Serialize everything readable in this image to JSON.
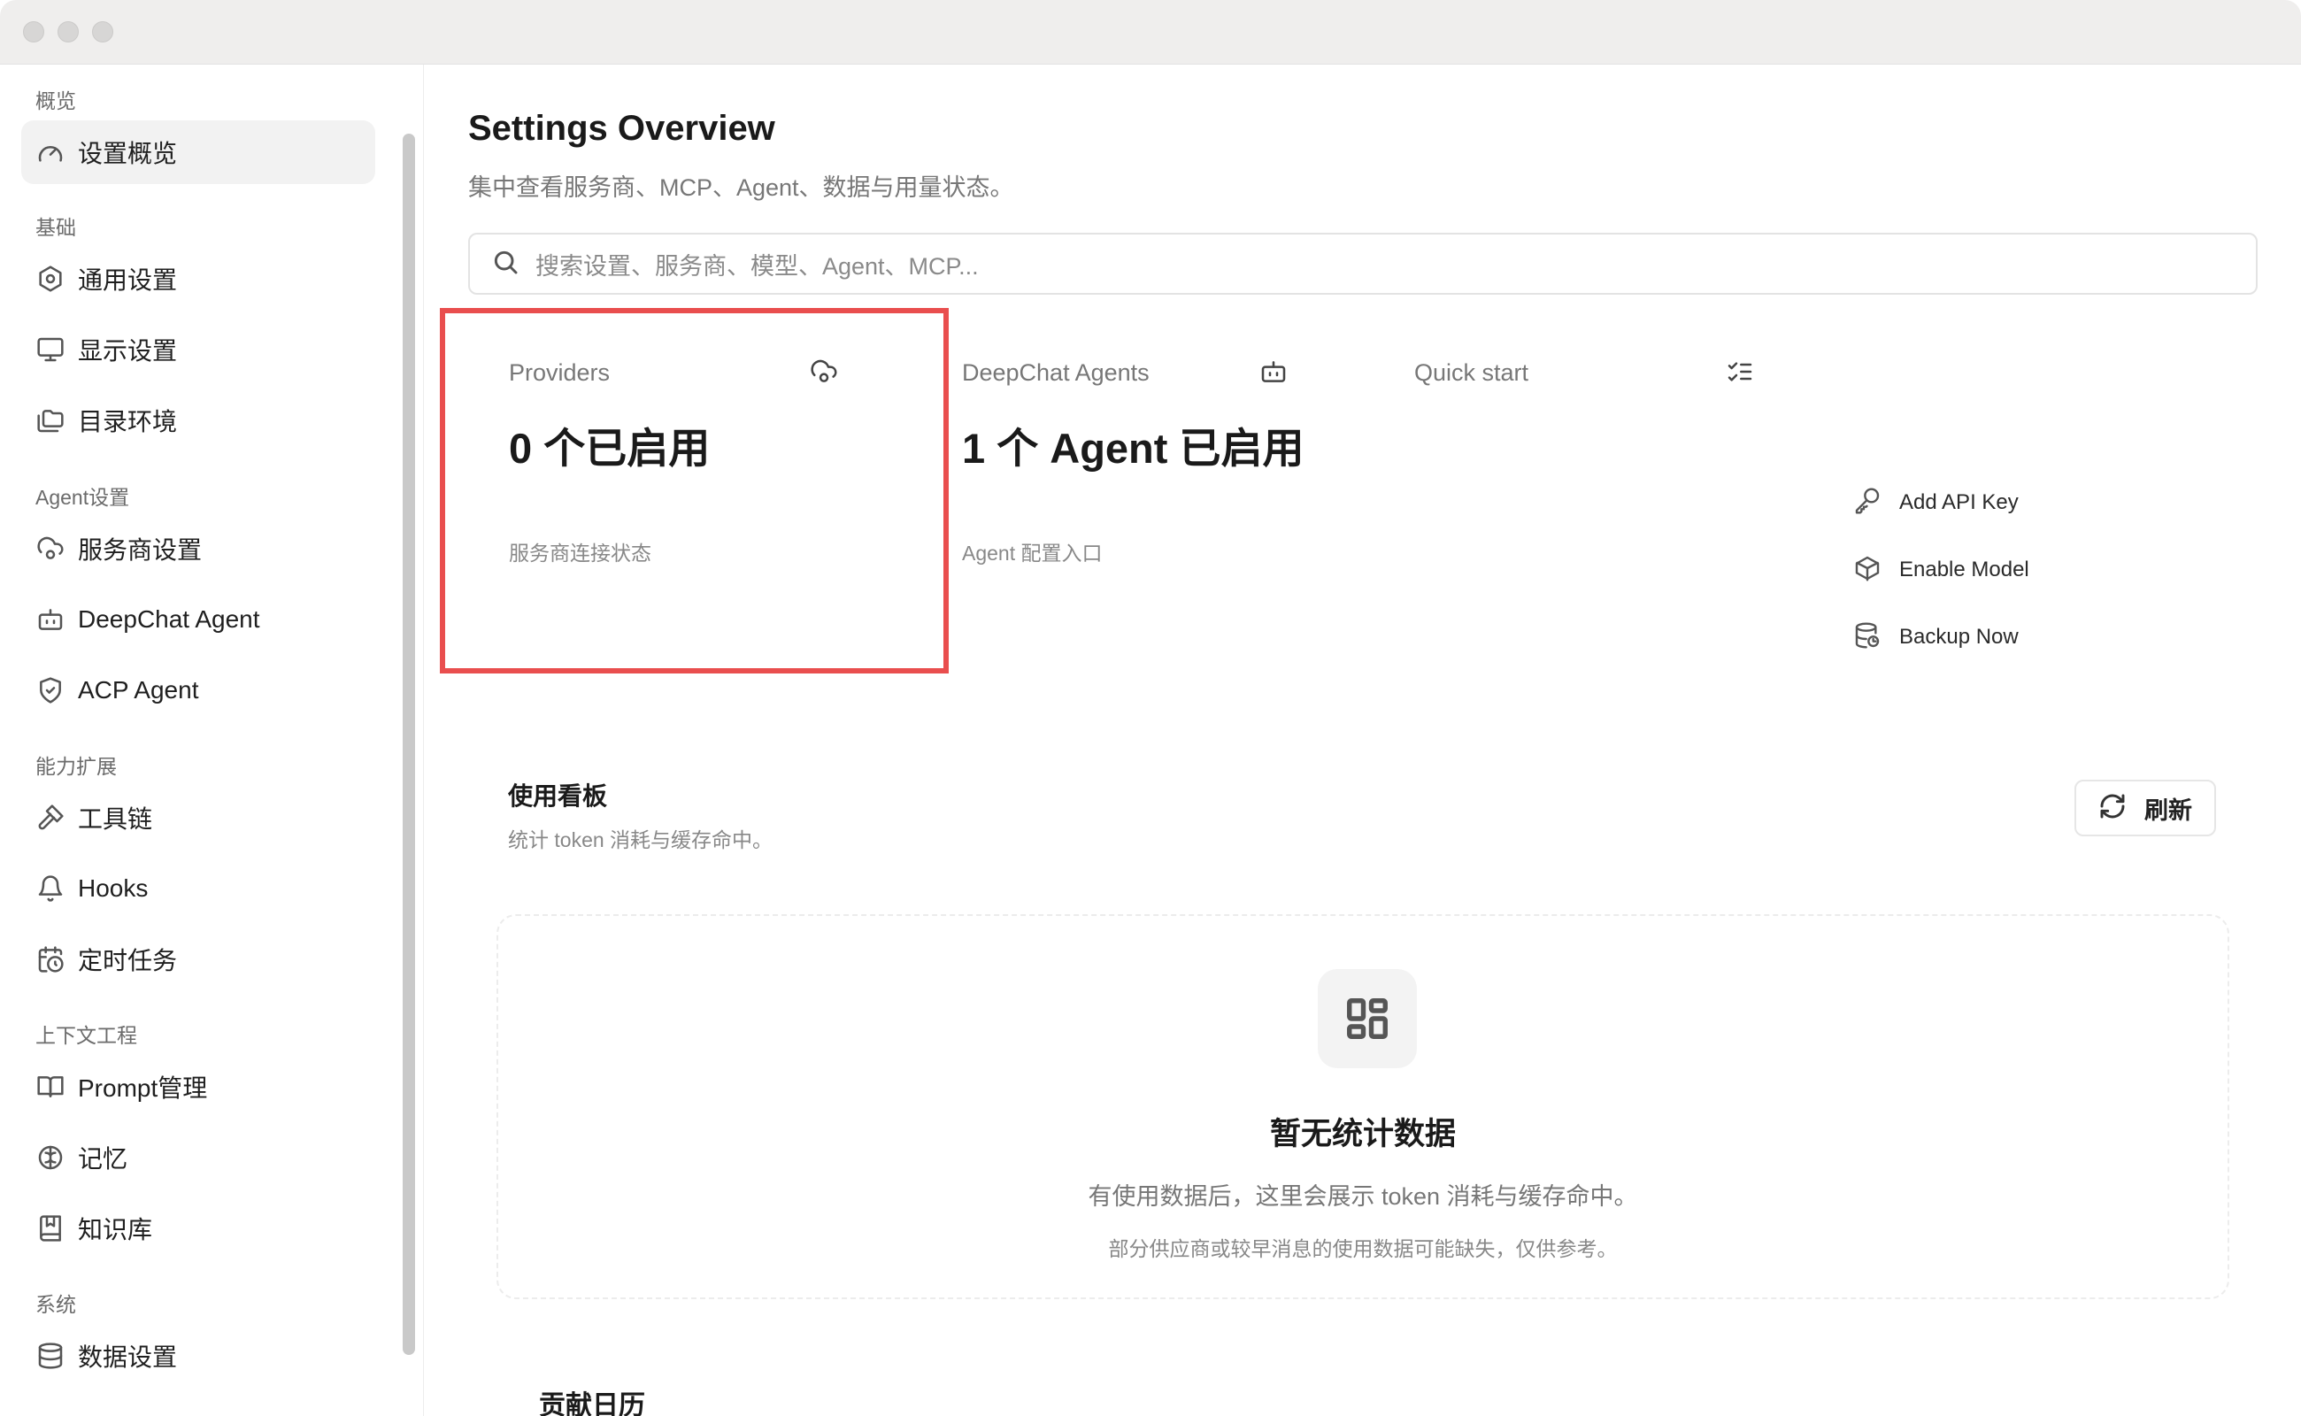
{
  "sidebar": {
    "sections": [
      {
        "title": "概览",
        "items": [
          {
            "label": "设置概览",
            "icon": "gauge-icon"
          }
        ]
      },
      {
        "title": "基础",
        "items": [
          {
            "label": "通用设置",
            "icon": "gear-icon"
          },
          {
            "label": "显示设置",
            "icon": "monitor-icon"
          },
          {
            "label": "目录环境",
            "icon": "folders-icon"
          }
        ]
      },
      {
        "title": "Agent设置",
        "items": [
          {
            "label": "服务商设置",
            "icon": "cloud-cog-icon"
          },
          {
            "label": "DeepChat Agent",
            "icon": "bot-icon"
          },
          {
            "label": "ACP Agent",
            "icon": "shield-check-icon"
          }
        ]
      },
      {
        "title": "能力扩展",
        "items": [
          {
            "label": "工具链",
            "icon": "hammer-icon"
          },
          {
            "label": "Hooks",
            "icon": "bell-icon"
          },
          {
            "label": "定时任务",
            "icon": "calendar-clock-icon"
          }
        ]
      },
      {
        "title": "上下文工程",
        "items": [
          {
            "label": "Prompt管理",
            "icon": "book-open-icon"
          },
          {
            "label": "记忆",
            "icon": "brain-icon"
          },
          {
            "label": "知识库",
            "icon": "bookmark-book-icon"
          }
        ]
      },
      {
        "title": "系统",
        "items": [
          {
            "label": "数据设置",
            "icon": "database-icon"
          }
        ]
      }
    ]
  },
  "main": {
    "title": "Settings Overview",
    "subtitle": "集中查看服务商、MCP、Agent、数据与用量状态。",
    "search_placeholder": "搜索设置、服务商、模型、Agent、MCP...",
    "cards": {
      "providers": {
        "title": "Providers",
        "value": "0 个已启用",
        "note": "服务商连接状态",
        "icon": "cloud-cog-icon"
      },
      "agents": {
        "title": "DeepChat Agents",
        "value": "1 个 Agent 已启用",
        "note": "Agent 配置入口",
        "icon": "bot-icon"
      },
      "quickstart": {
        "title": "Quick start",
        "icon": "list-checks-icon",
        "items": [
          {
            "label": "Add API Key",
            "icon": "key-icon"
          },
          {
            "label": "Enable Model",
            "icon": "box-icon"
          },
          {
            "label": "Backup Now",
            "icon": "database-backup-icon"
          }
        ]
      }
    },
    "usage": {
      "title": "使用看板",
      "subtitle": "统计 token 消耗与缓存命中。",
      "refresh_label": "刷新",
      "empty_title": "暂无统计数据",
      "empty_desc": "有使用数据后，这里会展示 token 消耗与缓存命中。",
      "empty_note": "部分供应商或较早消息的使用数据可能缺失，仅供参考。"
    },
    "contrib_title": "贡献日历"
  },
  "colors": {
    "highlight": "#e94e4e",
    "sidebar_active": "#f2f2f2"
  }
}
